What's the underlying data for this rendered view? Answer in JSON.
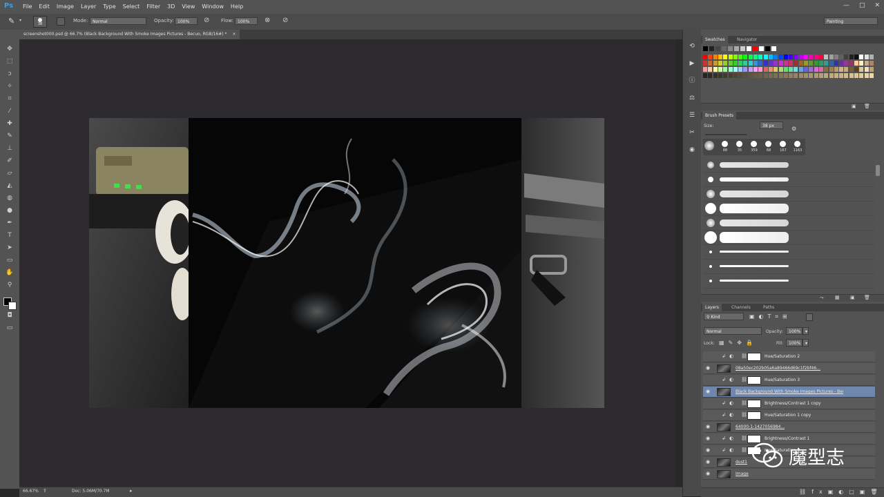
{
  "app": {
    "logo": "Ps",
    "workspace": "Painting"
  },
  "menu": [
    "File",
    "Edit",
    "Image",
    "Layer",
    "Type",
    "Select",
    "Filter",
    "3D",
    "View",
    "Window",
    "Help"
  ],
  "window_buttons": [
    "—",
    "□",
    "✕"
  ],
  "options": {
    "brush_size": "38",
    "mode_label": "Mode:",
    "mode_value": "Normal",
    "opacity_label": "Opacity:",
    "opacity_value": "100%",
    "flow_label": "Flow:",
    "flow_value": "100%"
  },
  "document_tab": {
    "title": "screenshot000.psd @ 66.7% (Black Background With Smoke Images  Pictures - Becuo, RGB/16#) *",
    "close": "×"
  },
  "status": {
    "zoom": "66.67%",
    "doc": "Doc: 5.06M/70.7M"
  },
  "swatches_panel": {
    "tabs": [
      "Swatches",
      "Navigator"
    ],
    "top_row_colors": [
      "#000000",
      "#222222",
      "#444444",
      "#666666",
      "#888888",
      "#aaaaaa",
      "#cccccc",
      "#ffffff",
      "#ff0000",
      "#ffffff",
      "#000000",
      "#ffffff"
    ],
    "color_rows": [
      [
        "#ff0000",
        "#ff4000",
        "#ff8000",
        "#ffbf00",
        "#ffff00",
        "#bfff00",
        "#80ff00",
        "#40ff00",
        "#00ff00",
        "#00ff40",
        "#00ff80",
        "#00ffbf",
        "#00ffff",
        "#00bfff",
        "#0080ff",
        "#0040ff",
        "#0000ff",
        "#4000ff",
        "#8000ff",
        "#bf00ff",
        "#ff00ff",
        "#ff00bf",
        "#ff0080",
        "#ff0040",
        "#c0c0c0",
        "#a0a0a0",
        "#808080",
        "#606060",
        "#404040",
        "#202020",
        "#101010",
        "#ffffff",
        "#e0e0e0",
        "#b0b0b0"
      ],
      [
        "#cc3333",
        "#cc6633",
        "#cc9933",
        "#cccc33",
        "#99cc33",
        "#66cc33",
        "#33cc33",
        "#33cc66",
        "#33cc99",
        "#33cccc",
        "#3399cc",
        "#3366cc",
        "#3333cc",
        "#6633cc",
        "#9933cc",
        "#cc33cc",
        "#cc3399",
        "#cc3366",
        "#993333",
        "#996633",
        "#999933",
        "#669933",
        "#339933",
        "#339966",
        "#339999",
        "#336699",
        "#333399",
        "#663399",
        "#993399",
        "#993366",
        "#ffcc99",
        "#ffeecc",
        "#ccaa88",
        "#aa8866"
      ],
      [
        "#ff9999",
        "#ffcc99",
        "#ffff99",
        "#ccff99",
        "#99ff99",
        "#99ffcc",
        "#99ffff",
        "#99ccff",
        "#9999ff",
        "#cc99ff",
        "#ff99ff",
        "#ff99cc",
        "#e06666",
        "#e09966",
        "#e0c266",
        "#a6e066",
        "#66e066",
        "#66e0a6",
        "#66e0e0",
        "#66a6e0",
        "#6666e0",
        "#a666e0",
        "#e066e0",
        "#e066a6",
        "#8a6d3b",
        "#a08050",
        "#b89968",
        "#d2b48c",
        "#c8a878",
        "#7a5c30",
        "#5c4020",
        "#dcc8a0",
        "#f0e0c0",
        "#c0a070"
      ]
    ]
  },
  "brush_panel": {
    "tabs": [
      "Brush Presets"
    ],
    "size_label": "Size:",
    "size_value": "38 px",
    "presets": [
      "88",
      "35",
      "359",
      "68",
      "167",
      "1163"
    ]
  },
  "layers_panel": {
    "tabs": [
      "Layers",
      "Channels",
      "Paths"
    ],
    "kind": "Kind",
    "blend": "Normal",
    "opacity_label": "Opacity:",
    "opacity_value": "100%",
    "lock_label": "Lock:",
    "fill_label": "Fill:",
    "fill_value": "100%",
    "layers": [
      {
        "name": "Hue/Saturation 2",
        "type": "adj",
        "visible": false
      },
      {
        "name": "08a50ec202b05a6a89466d69c1f2bf46...",
        "type": "pix",
        "visible": true
      },
      {
        "name": "Hue/Saturation 3",
        "type": "adj",
        "visible": false
      },
      {
        "name": "Black Background With Smoke Images  Pictures - Becuo...",
        "type": "pix",
        "visible": true,
        "selected": true
      },
      {
        "name": "Brightness/Contrast 1 copy",
        "type": "adj",
        "visible": false
      },
      {
        "name": "Hue/Saturation 1 copy",
        "type": "adj",
        "visible": false
      },
      {
        "name": "64000-1-1427056984...",
        "type": "pix",
        "visible": true
      },
      {
        "name": "Brightness/Contrast 1",
        "type": "adj",
        "visible": true
      },
      {
        "name": "Hue/Saturation 1",
        "type": "adj",
        "visible": true
      },
      {
        "name": "dust1",
        "type": "pix",
        "visible": true
      },
      {
        "name": "Image",
        "type": "pix",
        "visible": true
      }
    ]
  },
  "watermark": "魔型志",
  "colors": {
    "selected_layer": "#6f86ad",
    "panel": "#535353",
    "canvas_bg": "#2d2b30"
  }
}
